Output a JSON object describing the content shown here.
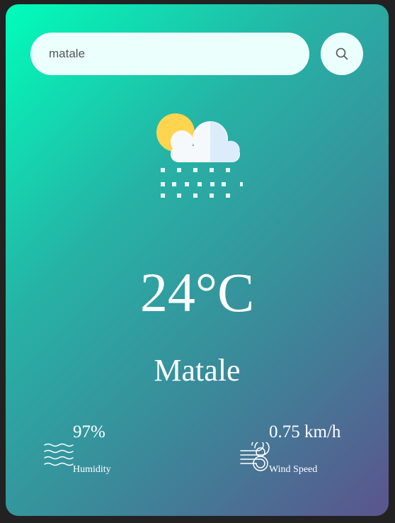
{
  "search": {
    "value": "matale",
    "button_icon": "search-icon"
  },
  "weather": {
    "icon": "partly-cloudy-snow-icon",
    "temperature": "24°C",
    "city": "Matale"
  },
  "details": {
    "humidity": {
      "value": "97%",
      "label": "Humidity",
      "icon": "humidity-waves-icon"
    },
    "wind": {
      "value": "0.75 km/h",
      "label": "Wind Speed",
      "icon": "wind-icon"
    }
  },
  "colors": {
    "gradient_start": "#00feba",
    "gradient_end": "#5b548e",
    "input_bg": "#ebfffc",
    "text": "#ffffff"
  }
}
